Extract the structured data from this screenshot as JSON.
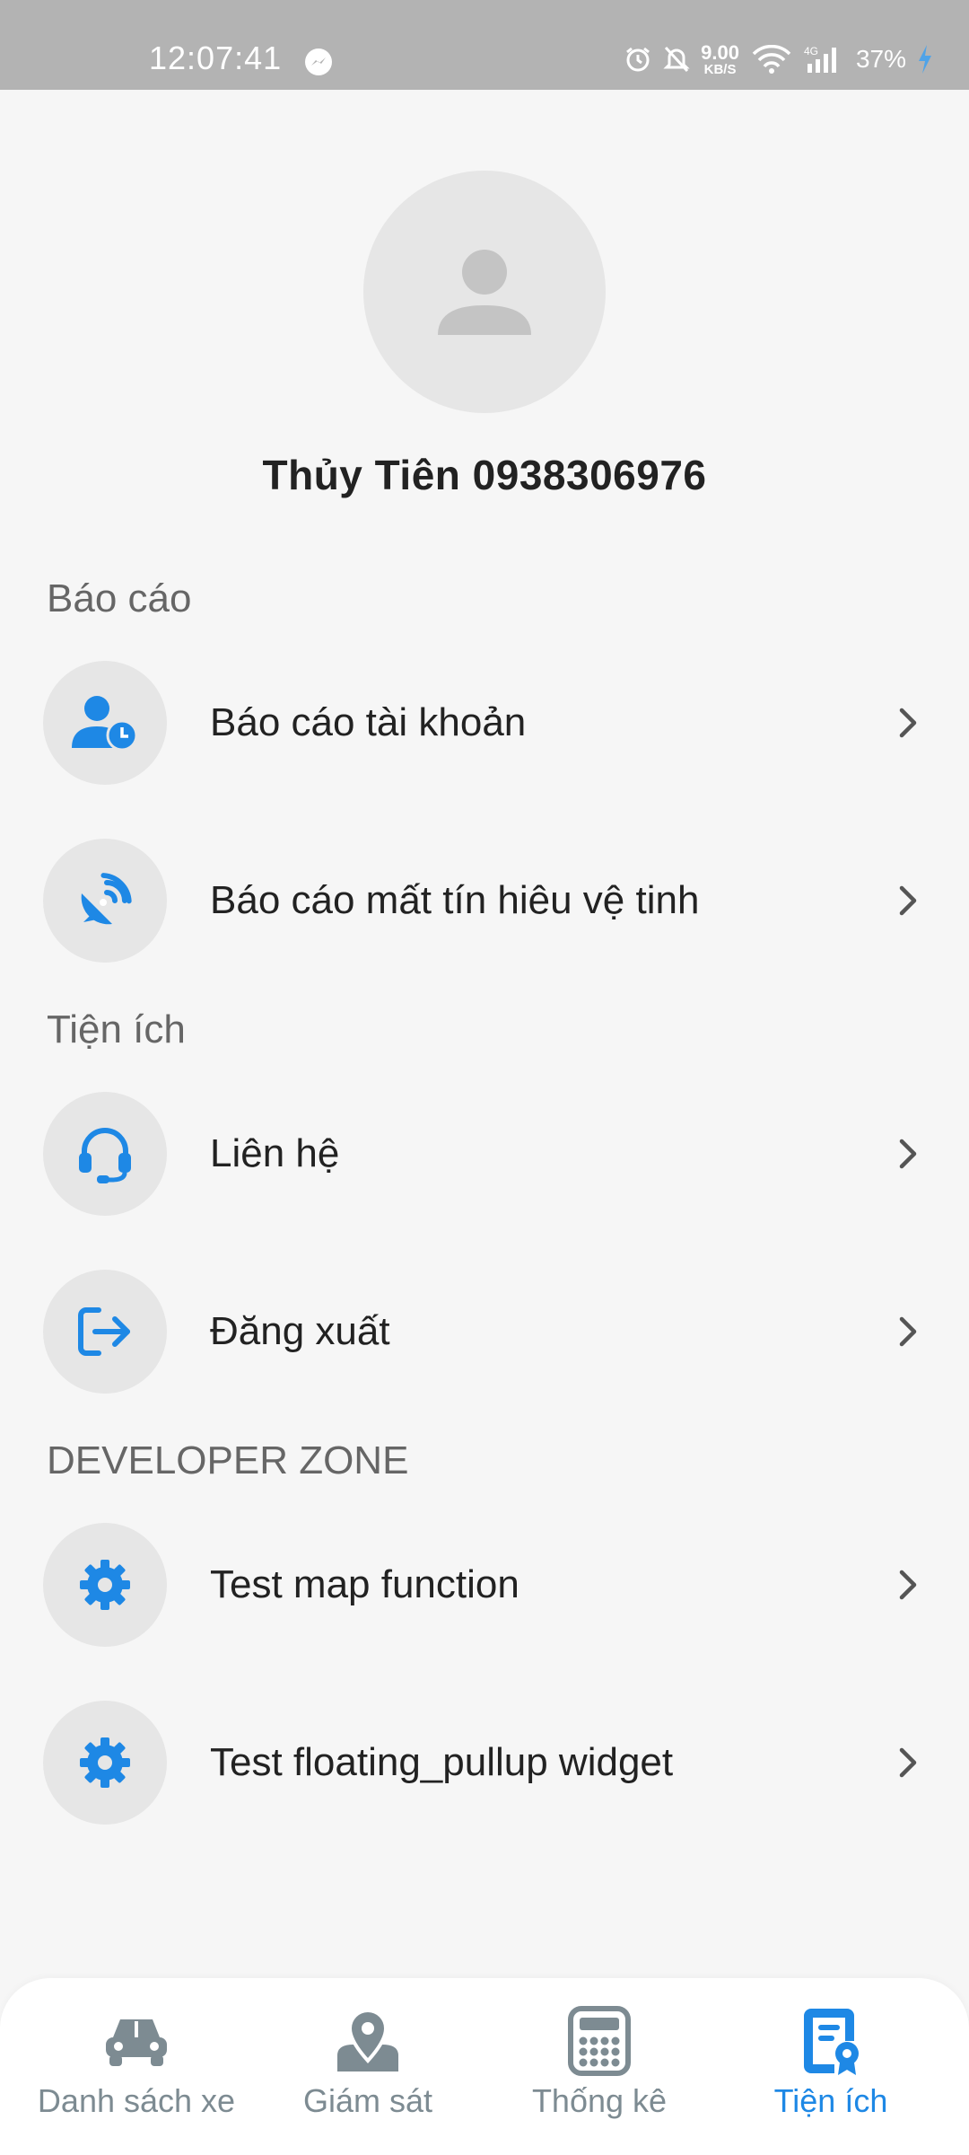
{
  "status_bar": {
    "time": "12:07:41",
    "net_speed_value": "9.00",
    "net_speed_unit": "KB/S",
    "battery": "37%",
    "icons": [
      "messenger-icon",
      "alarm-icon",
      "bell-off-icon",
      "wifi-icon",
      "signal-4g-icon",
      "charging-icon"
    ]
  },
  "profile": {
    "name": "Thủy Tiên 0938306976"
  },
  "sections": {
    "reports": {
      "title": "Báo cáo",
      "items": [
        {
          "label": "Báo cáo tài khoản",
          "icon": "user-clock-icon"
        },
        {
          "label": "Báo cáo mất tín hiêu vệ tinh",
          "icon": "satellite-dish-icon"
        }
      ]
    },
    "utilities": {
      "title": "Tiện ích",
      "items": [
        {
          "label": "Liên hệ",
          "icon": "headset-icon"
        },
        {
          "label": "Đăng xuất",
          "icon": "logout-icon"
        }
      ]
    },
    "developer": {
      "title": "DEVELOPER ZONE",
      "items": [
        {
          "label": "Test map function",
          "icon": "gear-icon"
        },
        {
          "label": "Test floating_pullup widget",
          "icon": "gear-icon"
        }
      ]
    }
  },
  "bottom_nav": {
    "items": [
      {
        "label": "Danh sách xe",
        "icon": "car-icon",
        "active": false
      },
      {
        "label": "Giám sát",
        "icon": "map-pin-icon",
        "active": false
      },
      {
        "label": "Thống kê",
        "icon": "calculator-icon",
        "active": false
      },
      {
        "label": "Tiện ích",
        "icon": "certificate-icon",
        "active": true
      }
    ]
  },
  "colors": {
    "accent": "#1e88e5",
    "inactive": "#7d8b92",
    "background": "#f6f6f6",
    "icon_bg": "#e6e6e6"
  }
}
